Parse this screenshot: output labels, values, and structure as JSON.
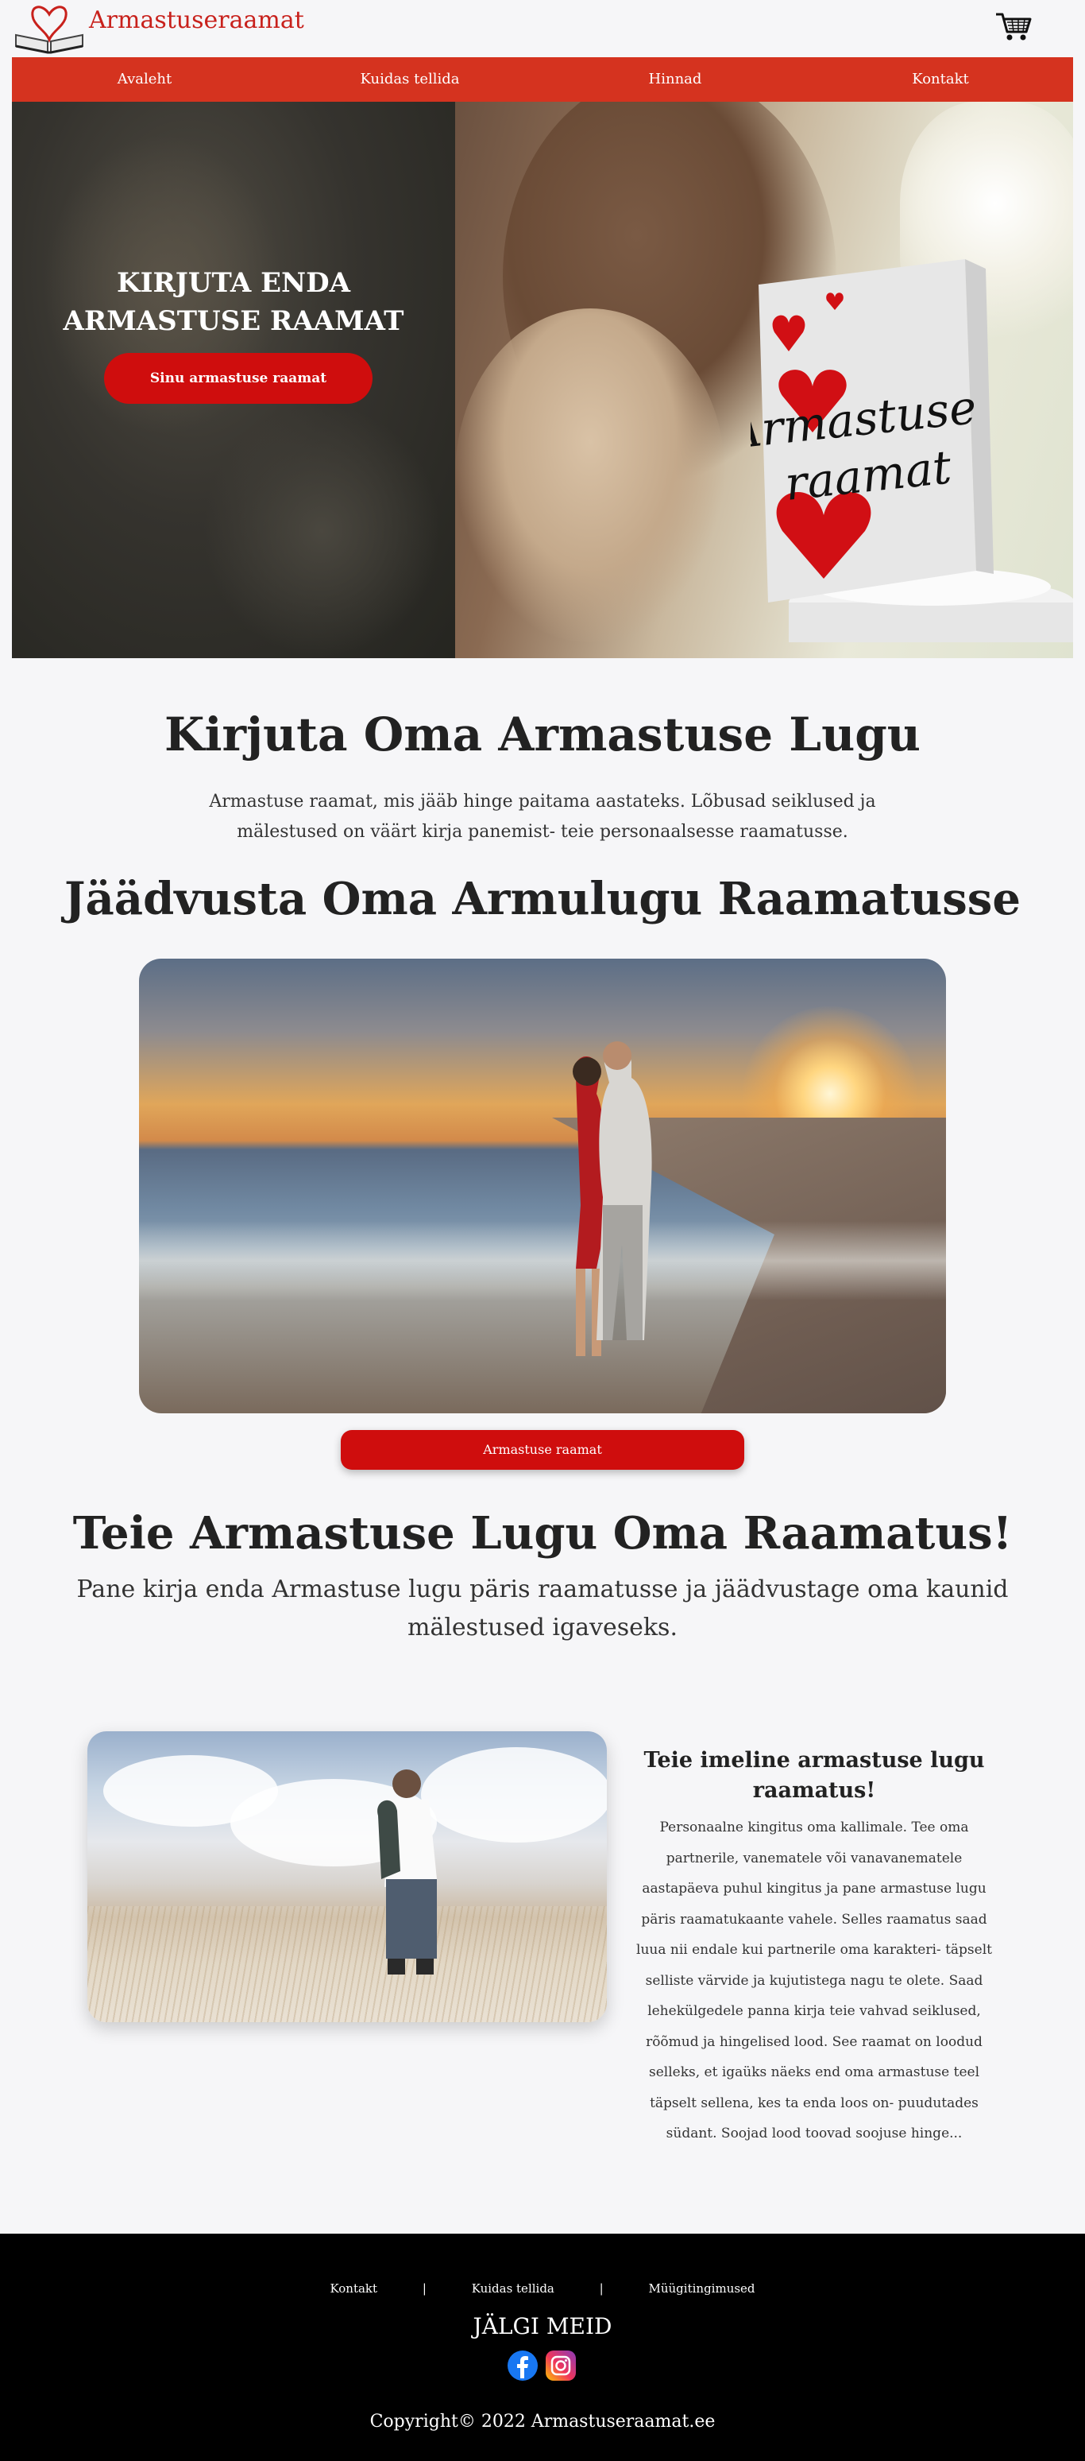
{
  "header": {
    "brand": "Armastuseraamat",
    "cart_icon": "cart-icon",
    "logo_icon": "book-heart-logo"
  },
  "nav": {
    "items": [
      {
        "label": "Avaleht"
      },
      {
        "label": "Kuidas tellida"
      },
      {
        "label": "Hinnad"
      },
      {
        "label": "Kontakt"
      }
    ]
  },
  "hero": {
    "title_line1": "KIRJUTA ENDA",
    "title_line2": "ARMASTUSE RAAMAT",
    "button_label": "Sinu armastuse raamat",
    "book_title_line1": "Armastuse",
    "book_title_line2": "raamat"
  },
  "intro": {
    "heading": "Kirjuta Oma Armastuse Lugu",
    "text": "Armastuse raamat, mis jääb hinge paitama aastateks. Lõbusad seiklused ja mälestused on väärt kirja panemist- teie personaalsesse raamatusse."
  },
  "gallery": {
    "heading": "Jäädvusta Oma Armulugu Raamatusse",
    "button_label": "Armastuse raamat"
  },
  "story": {
    "heading": "Teie Armastuse Lugu Oma Raamatus!",
    "subtitle": "Pane kirja enda Armastuse lugu päris raamatusse ja jäädvustage oma kaunid mälestused igaveseks."
  },
  "feature": {
    "title": "Teie imeline armastuse lugu raamatus!",
    "text": "Personaalne kingitus oma kallimale. Tee oma partnerile, vanematele või vanavanematele aastapäeva puhul kingitus ja pane armastuse lugu päris raamatukaante vahele. Selles raamatus saad luua nii endale kui partnerile oma karakteri- täpselt selliste värvide ja kujutistega nagu te olete. Saad lehekülgedele panna kirja teie vahvad seiklused, rõõmud ja hingelised lood. See raamat on loodud selleks, et igaüks näeks end oma armastuse teel täpselt sellena, kes ta enda loos on- puudutades südant. Soojad lood toovad soojuse hinge..."
  },
  "footer": {
    "links": [
      {
        "label": "Kontakt"
      },
      {
        "label": "Kuidas tellida"
      },
      {
        "label": "Müügitingimused"
      }
    ],
    "separator": "|",
    "follow_label": "JÄLGI MEID",
    "socials": [
      "facebook-icon",
      "instagram-icon"
    ],
    "copyright": "Copyright© 2022 Armastuseraamat.ee"
  },
  "colors": {
    "accent_red": "#d5331f",
    "button_red": "#cf0d0d",
    "brand_red": "#c8211c",
    "footer_bg": "#000000"
  }
}
